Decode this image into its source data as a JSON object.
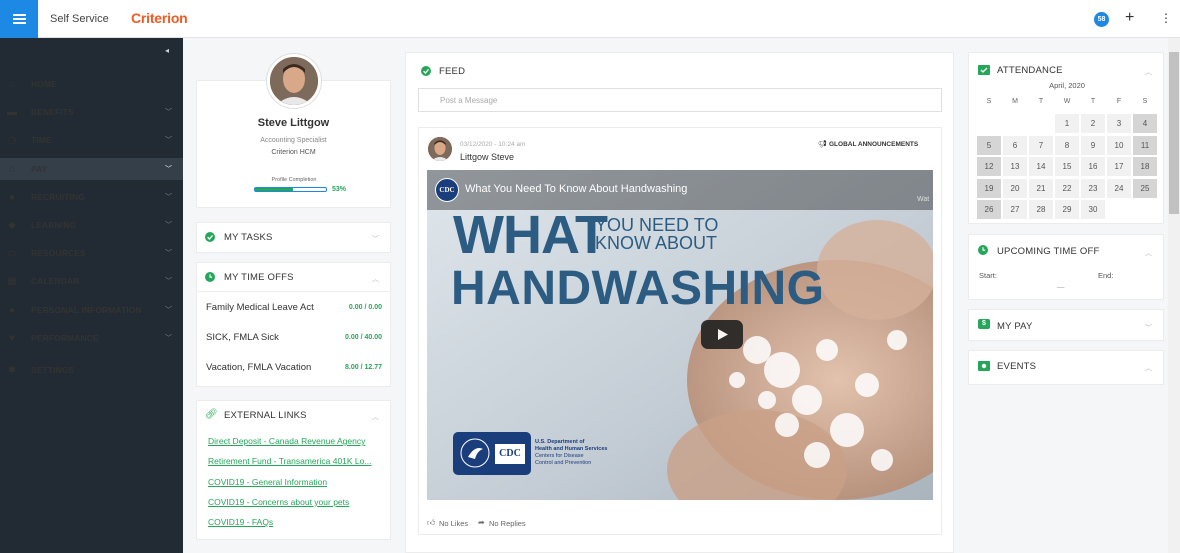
{
  "topbar": {
    "app_title": "Self Service",
    "logo": "Criterion",
    "notification_count": "58",
    "plus_glyph": "+",
    "kebab_glyph": "⋮"
  },
  "sidebar": {
    "collapse_glyph": "◂",
    "items": [
      {
        "label": "HOME",
        "icon": "home-icon"
      },
      {
        "label": "BENEFITS",
        "icon": "briefcase-icon"
      },
      {
        "label": "TIME",
        "icon": "clock-icon"
      },
      {
        "label": "PAY",
        "icon": "bank-icon"
      },
      {
        "label": "RECRUITING",
        "icon": "users-icon"
      },
      {
        "label": "LEARNING",
        "icon": "graduation-cap-icon"
      },
      {
        "label": "RESOURCES",
        "icon": "folder-icon"
      },
      {
        "label": "CALENDAR",
        "icon": "calendar-icon"
      },
      {
        "label": "PERSONAL INFORMATION",
        "icon": "user-icon"
      },
      {
        "label": "PERFORMANCE",
        "icon": "heart-icon"
      },
      {
        "label": "SETTINGS",
        "icon": "gear-icon"
      }
    ],
    "active_item": "PAY"
  },
  "profile": {
    "name": "Steve Littgow",
    "title": "Accounting Specialist",
    "company": "Criterion HCM",
    "completion_label": "Profile Completion",
    "completion_pct": "53%",
    "completion_fraction": 0.53
  },
  "tasks": {
    "title": "MY TASKS"
  },
  "time_offs": {
    "title": "MY TIME OFFS",
    "rows": [
      {
        "label": "Family Medical Leave Act",
        "value": "0.00 / 0.00"
      },
      {
        "label": "SICK, FMLA Sick",
        "value": "0.00 / 40.00"
      },
      {
        "label": "Vacation, FMLA Vacation",
        "value": "8.00 / 12.77"
      }
    ]
  },
  "external_links": {
    "title": "EXTERNAL LINKS",
    "links": [
      "Direct Deposit - Canada Revenue Agency",
      "Retirement Fund - Transamerica 401K Lo...",
      "COVID19 - General Information",
      "COVID19 - Concerns about your pets",
      "COVID19 - FAQs"
    ]
  },
  "feed": {
    "title": "FEED",
    "post_placeholder": "Post a Message",
    "post": {
      "date": "03/12/2020 - 10:24 am",
      "author": "Littgow Steve",
      "category": "GLOBAL ANNOUNCEMENTS",
      "video_badge": "CDC",
      "video_title": "What You Need To Know About Handwashing",
      "video_corner": "Wat",
      "headline_big1": "WHAT",
      "headline_small1": "YOU NEED TO",
      "headline_small2": "KNOW ABOUT",
      "headline_big2": "HANDWASHING",
      "logo_badge": "CDC",
      "logo_line1": "U.S. Department of",
      "logo_line2": "Health and Human Services",
      "logo_line3": "Centers for Disease",
      "logo_line4": "Control and Prevention",
      "likes": "No Likes",
      "replies": "No Replies"
    }
  },
  "attendance": {
    "title": "ATTENDANCE",
    "month": "April, 2020",
    "weekdays": [
      "S",
      "M",
      "T",
      "W",
      "T",
      "F",
      "S"
    ],
    "rows": [
      [
        "",
        "",
        "",
        "1",
        "2",
        "3",
        "4"
      ],
      [
        "5",
        "6",
        "7",
        "8",
        "9",
        "10",
        "11"
      ],
      [
        "12",
        "13",
        "14",
        "15",
        "16",
        "17",
        "18"
      ],
      [
        "19",
        "20",
        "21",
        "22",
        "23",
        "24",
        "25"
      ],
      [
        "26",
        "27",
        "28",
        "29",
        "30",
        "",
        ""
      ]
    ]
  },
  "upcoming_time_off": {
    "title": "UPCOMING TIME OFF",
    "start_label": "Start:",
    "end_label": "End:",
    "dash": "—"
  },
  "my_pay": {
    "title": "MY PAY"
  },
  "events": {
    "title": "EVENTS"
  },
  "colors": {
    "accent": "#1e88e5",
    "green": "#26a65b",
    "brand": "#f15a22",
    "sidebar": "#222b33"
  }
}
